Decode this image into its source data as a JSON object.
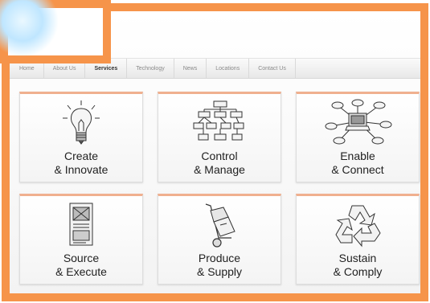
{
  "nav": {
    "items": [
      "Home",
      "About Us",
      "Services",
      "Technology",
      "News",
      "Locations",
      "Contact Us"
    ],
    "active": "Services"
  },
  "tiles": [
    {
      "line1": "Create",
      "line2": "& Innovate",
      "icon": "lightbulb-icon"
    },
    {
      "line1": "Control",
      "line2": "& Manage",
      "icon": "flowchart-icon"
    },
    {
      "line1": "Enable",
      "line2": "& Connect",
      "icon": "network-icon"
    },
    {
      "line1": "Source",
      "line2": "& Execute",
      "icon": "document-icon"
    },
    {
      "line1": "Produce",
      "line2": "& Supply",
      "icon": "hand-truck-icon"
    },
    {
      "line1": "Sustain",
      "line2": "& Comply",
      "icon": "recycle-icon"
    }
  ],
  "colors": {
    "accent": "#f6944a",
    "tile_top": "#f0b08f"
  }
}
